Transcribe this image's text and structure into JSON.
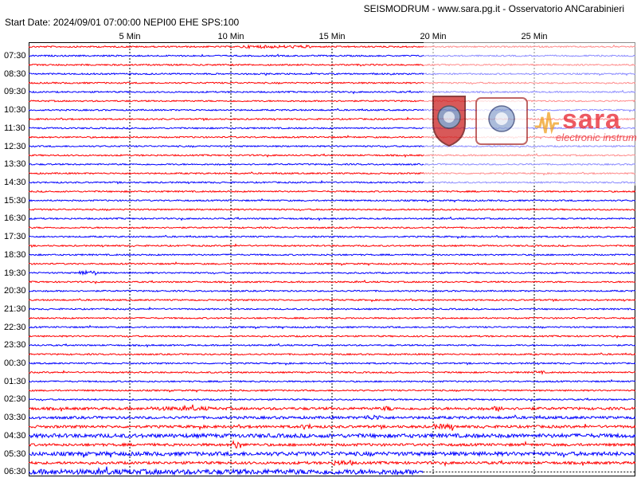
{
  "header": {
    "title": "SEISMODRUM - www.sara.pg.it - Osservatorio ANCarabinieri",
    "start": "Start Date: 2024/09/01 07:00:00 NEPI00 EHE  SPS:100"
  },
  "logos": {
    "brand": "sara",
    "brand_sub": "electronic instruments",
    "seal_mid_text": "Istituto Italiano Esperienza Sismica"
  },
  "colors": {
    "red_trace": "#ff0000",
    "blue_trace": "#0000ff",
    "grid_line": "#000000",
    "brand": "#e8242e"
  },
  "chart_data": {
    "type": "line",
    "x_unit": "minutes",
    "x_range": [
      0,
      30
    ],
    "x_ticks": [
      "5 Min",
      "10 Min",
      "15 Min",
      "20 Min",
      "25 Min"
    ],
    "x_tick_values": [
      5,
      10,
      15,
      20,
      25
    ],
    "row_minutes": 15,
    "row_colors": [
      "red",
      "blue"
    ],
    "hour_labels": [
      "07:30",
      "08:30",
      "09:30",
      "10:30",
      "11:30",
      "12:30",
      "13:30",
      "14:30",
      "15:30",
      "16:30",
      "17:30",
      "18:30",
      "19:30",
      "20:30",
      "21:30",
      "22:30",
      "23:30",
      "00:30",
      "01:30",
      "02:30",
      "03:30",
      "04:30",
      "05:30",
      "06:30"
    ],
    "row_count": 48,
    "last_row_end_minute": 19.5,
    "events": [
      {
        "row": 0,
        "start_min": 10.5,
        "end_min": 14.0,
        "amp": 2
      },
      {
        "row": 25,
        "start_min": 2.5,
        "end_min": 3.5,
        "amp": 3
      },
      {
        "row": 36,
        "start_min": 25.0,
        "end_min": 25.5,
        "amp": 2
      },
      {
        "row": 40,
        "start_min": 17.5,
        "end_min": 18.0,
        "amp": 2
      },
      {
        "row": 40,
        "start_min": 23.0,
        "end_min": 23.5,
        "amp": 2
      },
      {
        "row": 40,
        "start_min": 6.0,
        "end_min": 9.0,
        "amp": 1.5
      },
      {
        "row": 41,
        "start_min": 16.5,
        "end_min": 17.5,
        "amp": 2
      },
      {
        "row": 42,
        "start_min": 13.5,
        "end_min": 14.0,
        "amp": 2
      },
      {
        "row": 42,
        "start_min": 20.0,
        "end_min": 21.0,
        "amp": 2
      },
      {
        "row": 43,
        "start_min": 0.0,
        "end_min": 30.0,
        "amp": 1.5
      },
      {
        "row": 44,
        "start_min": 10.0,
        "end_min": 10.5,
        "amp": 3
      },
      {
        "row": 45,
        "start_min": 0.0,
        "end_min": 30.0,
        "amp": 1.5
      },
      {
        "row": 46,
        "start_min": 15.0,
        "end_min": 16.0,
        "amp": 2
      },
      {
        "row": 47,
        "start_min": 0.0,
        "end_min": 19.5,
        "amp": 2
      }
    ]
  }
}
